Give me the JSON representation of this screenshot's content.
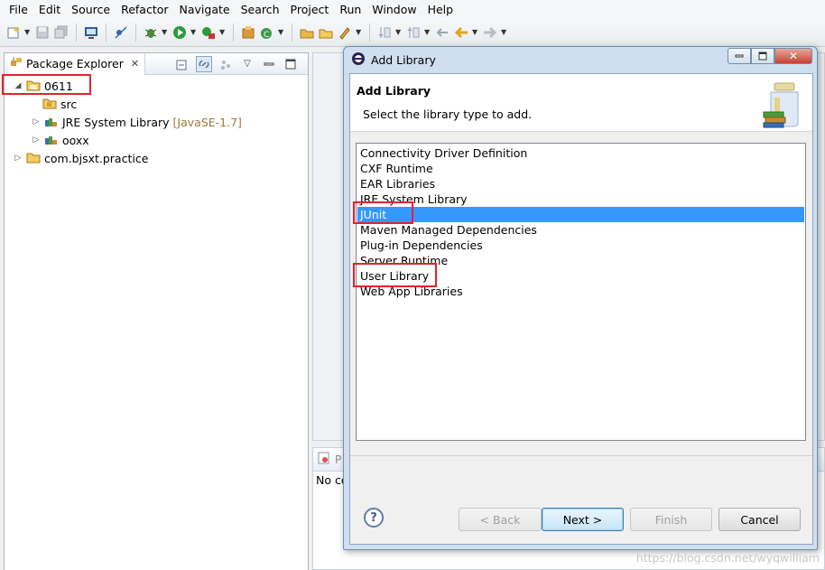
{
  "menu": [
    "File",
    "Edit",
    "Source",
    "Refactor",
    "Navigate",
    "Search",
    "Project",
    "Run",
    "Window",
    "Help"
  ],
  "package_explorer": {
    "title": "Package Explorer",
    "tree": [
      {
        "label": "0611",
        "expanded": true,
        "icon": "project-folder-icon"
      },
      {
        "label": "src",
        "icon": "source-folder-icon"
      },
      {
        "label": "JRE System Library",
        "suffix": "[JavaSE-1.7]",
        "icon": "library-icon"
      },
      {
        "label": "ooxx",
        "icon": "library-icon"
      },
      {
        "label": "com.bjsxt.practice",
        "icon": "project-folder-icon"
      }
    ]
  },
  "bottom_panel": {
    "tab_label": "P",
    "text": "No co"
  },
  "dialog": {
    "title": "Add Library",
    "banner_title": "Add Library",
    "banner_desc": "Select the library type to add.",
    "libraries": [
      "Connectivity Driver Definition",
      "CXF Runtime",
      "EAR Libraries",
      "JRE System Library",
      "JUnit",
      "Maven Managed Dependencies",
      "Plug-in Dependencies",
      "Server Runtime",
      "User Library",
      "Web App Libraries"
    ],
    "selected": "JUnit",
    "buttons": {
      "back": "< Back",
      "next": "Next >",
      "finish": "Finish",
      "cancel": "Cancel"
    }
  },
  "watermark": "https://blog.csdn.net/wyqwilliam",
  "colors": {
    "selection": "#3399ff",
    "annotation_red": "#e0242b"
  }
}
